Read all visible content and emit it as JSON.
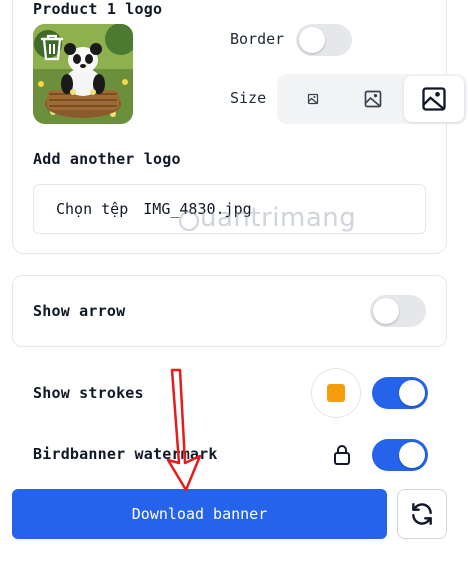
{
  "product_logo": {
    "title": "Product 1 logo",
    "thumbnail_icon": "panda-image",
    "delete_icon": "trash-icon"
  },
  "border": {
    "label": "Border",
    "enabled": false
  },
  "size": {
    "label": "Size",
    "options": [
      {
        "icon": "image-small-icon",
        "selected": false
      },
      {
        "icon": "image-medium-icon",
        "selected": false
      },
      {
        "icon": "image-large-icon",
        "selected": true
      }
    ]
  },
  "add_logo": {
    "title": "Add another logo",
    "button_label": "Chọn tệp",
    "file_name": "IMG_4830.jpg"
  },
  "watermark_text": "uantrimang",
  "show_arrow": {
    "label": "Show arrow",
    "enabled": false
  },
  "show_strokes": {
    "label": "Show strokes",
    "enabled": true,
    "color": "#f59e0b"
  },
  "birdbanner_watermark": {
    "label": "Birdbanner watermark",
    "enabled": true,
    "lock_icon": "lock-icon"
  },
  "actions": {
    "download_label": "Download banner",
    "refresh_icon": "refresh-icon"
  },
  "colors": {
    "accent": "#2563eb",
    "annotation": "#e11d1d"
  }
}
